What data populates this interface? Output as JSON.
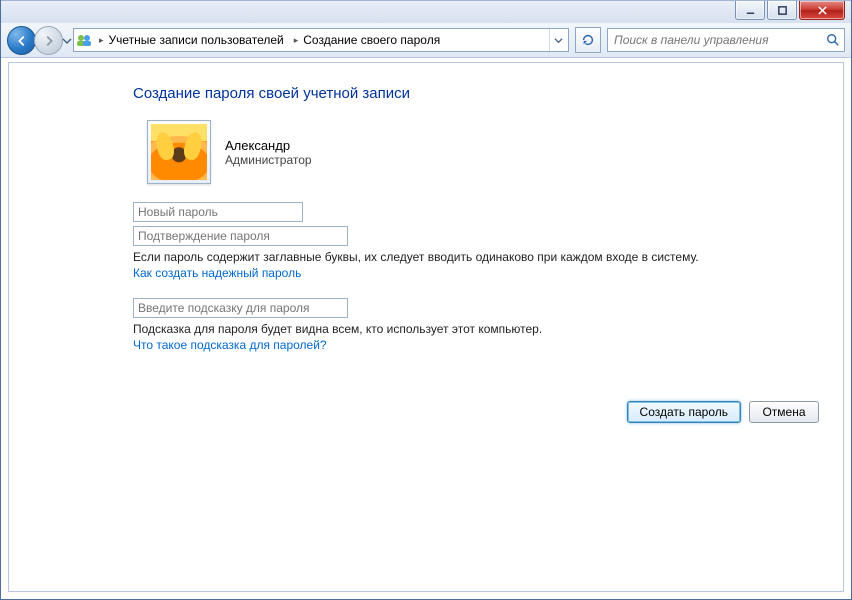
{
  "window": {
    "min_tip": "Minimize",
    "max_tip": "Maximize",
    "close_tip": "Close"
  },
  "breadcrumb": {
    "item1": "Учетные записи пользователей",
    "item2": "Создание своего пароля"
  },
  "search": {
    "placeholder": "Поиск в панели управления"
  },
  "page": {
    "title": "Создание пароля своей учетной записи"
  },
  "user": {
    "name": "Александр",
    "role": "Администратор"
  },
  "fields": {
    "new_password_ph": "Новый пароль",
    "confirm_password_ph": "Подтверждение пароля",
    "hint_ph": "Введите подсказку для пароля"
  },
  "notes": {
    "caps": "Если пароль содержит заглавные буквы, их следует вводить одинаково при каждом входе в систему.",
    "hint_visible": "Подсказка для пароля будет видна всем, кто использует этот компьютер."
  },
  "links": {
    "strong_pw": "Как создать надежный пароль",
    "what_hint": "Что такое подсказка для паролей?"
  },
  "buttons": {
    "create": "Создать пароль",
    "cancel": "Отмена"
  }
}
